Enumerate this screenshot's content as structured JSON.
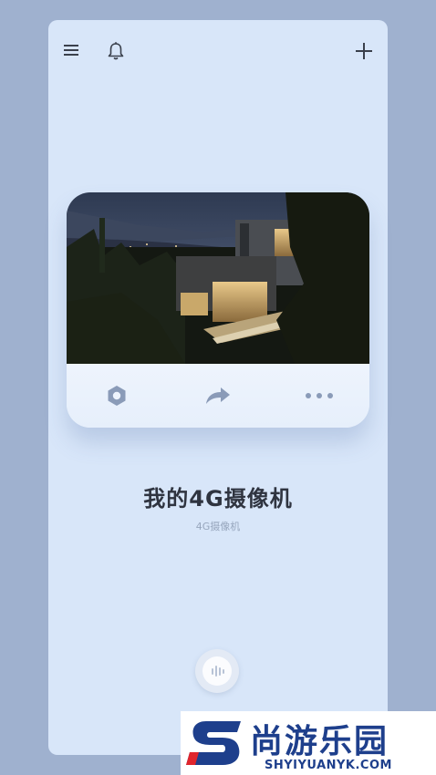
{
  "header": {
    "menu_icon": "menu-icon",
    "bell_icon": "bell-icon",
    "add_icon": "plus-icon"
  },
  "camera_card": {
    "image_desc_icon": "camera-preview",
    "actions": [
      {
        "name": "settings",
        "icon": "gear-icon"
      },
      {
        "name": "share",
        "icon": "share-icon"
      },
      {
        "name": "more",
        "icon": "more-icon"
      }
    ]
  },
  "device": {
    "title": "我的4G摄像机",
    "subtitle": "4G摄像机"
  },
  "fab": {
    "icon": "voice-icon"
  },
  "watermark": {
    "brand": "尚游乐园",
    "url": "SHYIYUANYK.COM"
  },
  "colors": {
    "background": "#9fb1cf",
    "phone": "#d8e6f9",
    "watermark": "#1e3f8c"
  }
}
